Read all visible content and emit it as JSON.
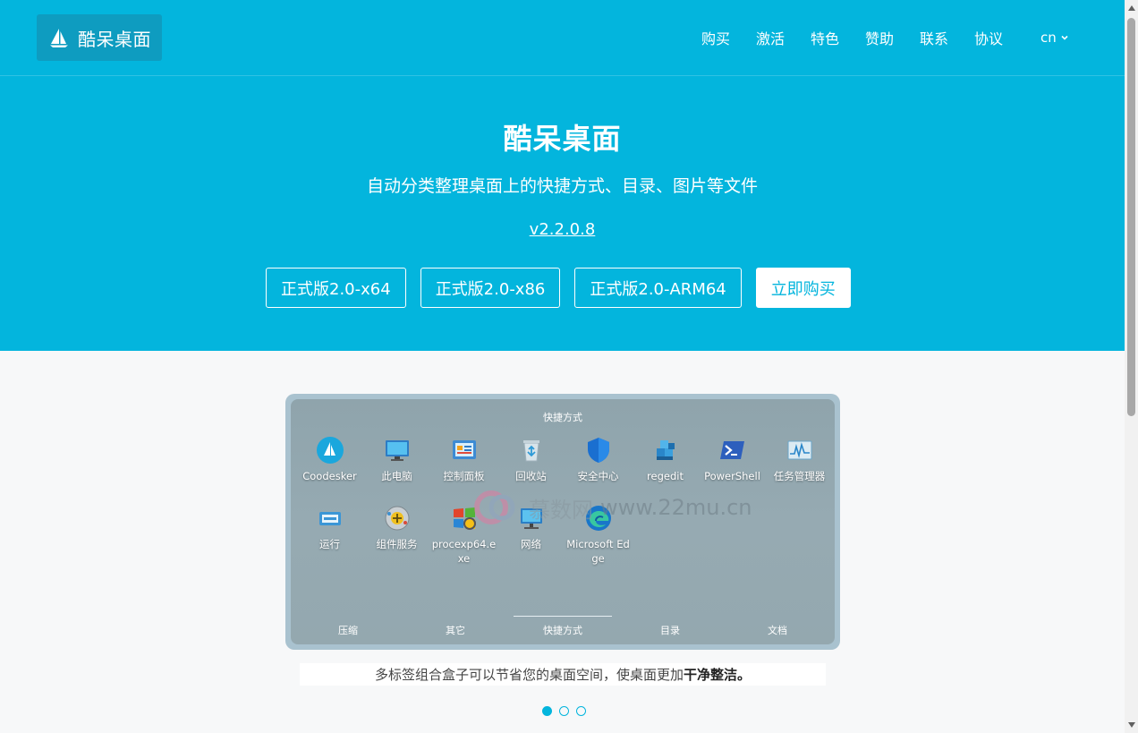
{
  "nav": {
    "brand": "酷呆桌面",
    "links": [
      "购买",
      "激活",
      "特色",
      "赞助",
      "联系",
      "协议"
    ],
    "lang": "cn"
  },
  "hero": {
    "title": "酷呆桌面",
    "subtitle": "自动分类整理桌面上的快捷方式、目录、图片等文件",
    "version": "v2.2.0.8",
    "buttons": [
      "正式版2.0-x64",
      "正式版2.0-x86",
      "正式版2.0-ARM64",
      "立即购买"
    ]
  },
  "showcase": {
    "panel_title": "快捷方式",
    "apps": [
      {
        "label": "Coodesker",
        "icon": "coodesker-icon"
      },
      {
        "label": "此电脑",
        "icon": "monitor-icon"
      },
      {
        "label": "控制面板",
        "icon": "control-panel-icon"
      },
      {
        "label": "回收站",
        "icon": "recycle-bin-icon"
      },
      {
        "label": "安全中心",
        "icon": "shield-icon"
      },
      {
        "label": "regedit",
        "icon": "regedit-icon"
      },
      {
        "label": "PowerShell",
        "icon": "powershell-icon"
      },
      {
        "label": "任务管理器",
        "icon": "task-manager-icon"
      },
      {
        "label": "运行",
        "icon": "run-icon"
      },
      {
        "label": "组件服务",
        "icon": "component-services-icon"
      },
      {
        "label": "procexp64.exe",
        "icon": "procexp-icon"
      },
      {
        "label": "网络",
        "icon": "network-icon"
      },
      {
        "label": "Microsoft Edge",
        "icon": "edge-icon"
      }
    ],
    "tabs": [
      "压缩",
      "其它",
      "快捷方式",
      "目录",
      "文档"
    ],
    "active_tab": "快捷方式",
    "watermark": {
      "brand": "慕数网",
      "url": "www.22mu.cn"
    }
  },
  "caption": {
    "text": "多标签组合盒子可以节省您的桌面空间，使桌面更加",
    "bold": "干净整洁。"
  },
  "carousel": {
    "count": 3,
    "active": 0
  },
  "colors": {
    "primary": "#03b5dd",
    "brand_box": "#0e9cc0"
  }
}
